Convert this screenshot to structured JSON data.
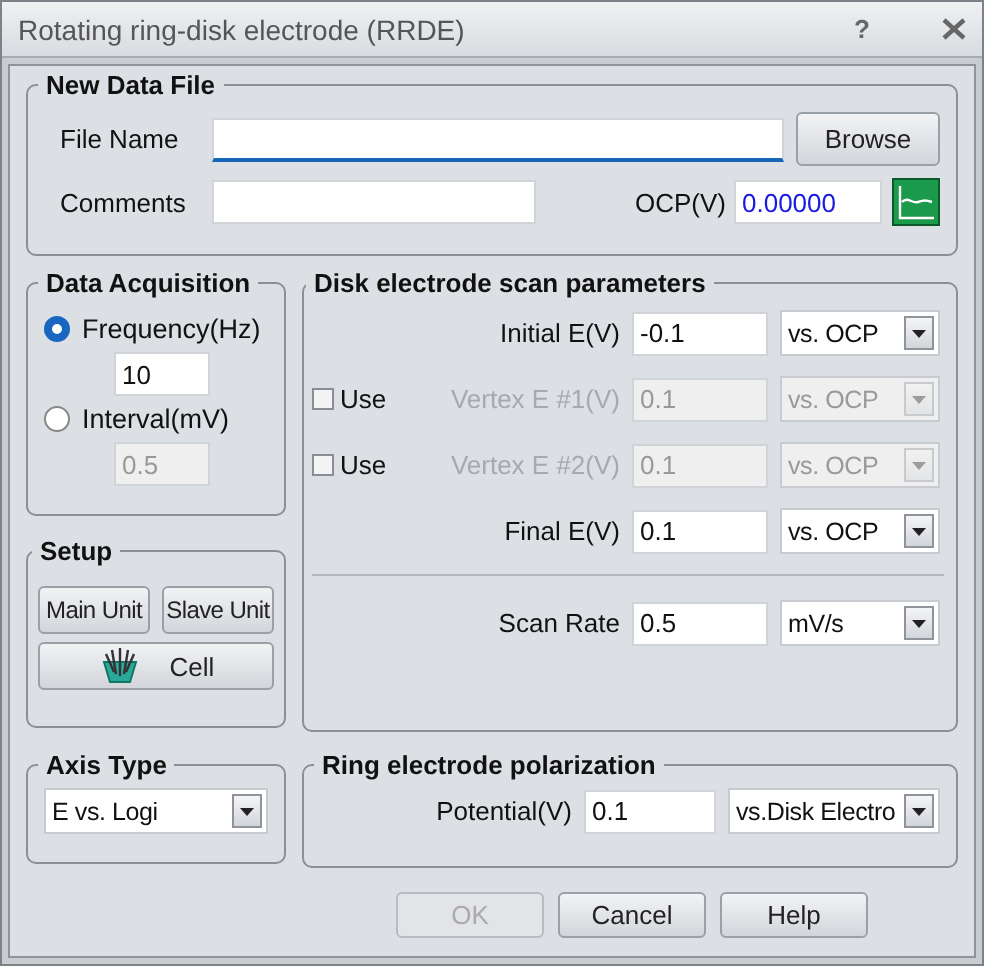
{
  "window": {
    "title": "Rotating ring-disk electrode (RRDE)",
    "help": "?"
  },
  "new_data_file": {
    "title": "New Data File",
    "file_name": {
      "label": "File Name",
      "focused": true
    },
    "browse": "Browse",
    "comments": {
      "label": "Comments"
    },
    "ocp": {
      "label": "OCP(V)",
      "value": "0.00000"
    }
  },
  "data_acquisition": {
    "title": "Data Acquisition",
    "options": [
      {
        "label": "Frequency(Hz)",
        "selected": true,
        "value": "10"
      },
      {
        "label": "Interval(mV)",
        "selected": false,
        "value": "0.5"
      }
    ]
  },
  "setup": {
    "title": "Setup",
    "units": [
      "Main Unit",
      "Slave Unit"
    ],
    "cell": "Cell"
  },
  "disk": {
    "title": "Disk electrode scan parameters",
    "rows": [
      {
        "kind": "param",
        "label": "Initial E(V)",
        "value": "-0.1",
        "reference": "vs. OCP",
        "disabled": false
      },
      {
        "kind": "optional",
        "use": "Use",
        "checked": false,
        "label": "Vertex E #1(V)",
        "value": "0.1",
        "reference": "vs. OCP",
        "disabled": true
      },
      {
        "kind": "optional",
        "use": "Use",
        "checked": false,
        "label": "Vertex E #2(V)",
        "value": "0.1",
        "reference": "vs. OCP",
        "disabled": true
      },
      {
        "kind": "param",
        "label": "Final E(V)",
        "value": "0.1",
        "reference": "vs. OCP",
        "disabled": false
      }
    ],
    "scan_rate": {
      "label": "Scan Rate",
      "value": "0.5",
      "unit": "mV/s"
    }
  },
  "axis_type": {
    "title": "Axis Type",
    "value": "E vs. Logi"
  },
  "ring": {
    "title": "Ring electrode polarization",
    "label": "Potential(V)",
    "value": "0.1",
    "reference": "vs.Disk Electro"
  },
  "buttons": [
    {
      "label": "OK",
      "disabled": true
    },
    {
      "label": "Cancel",
      "disabled": false
    },
    {
      "label": "Help",
      "disabled": false
    }
  ]
}
